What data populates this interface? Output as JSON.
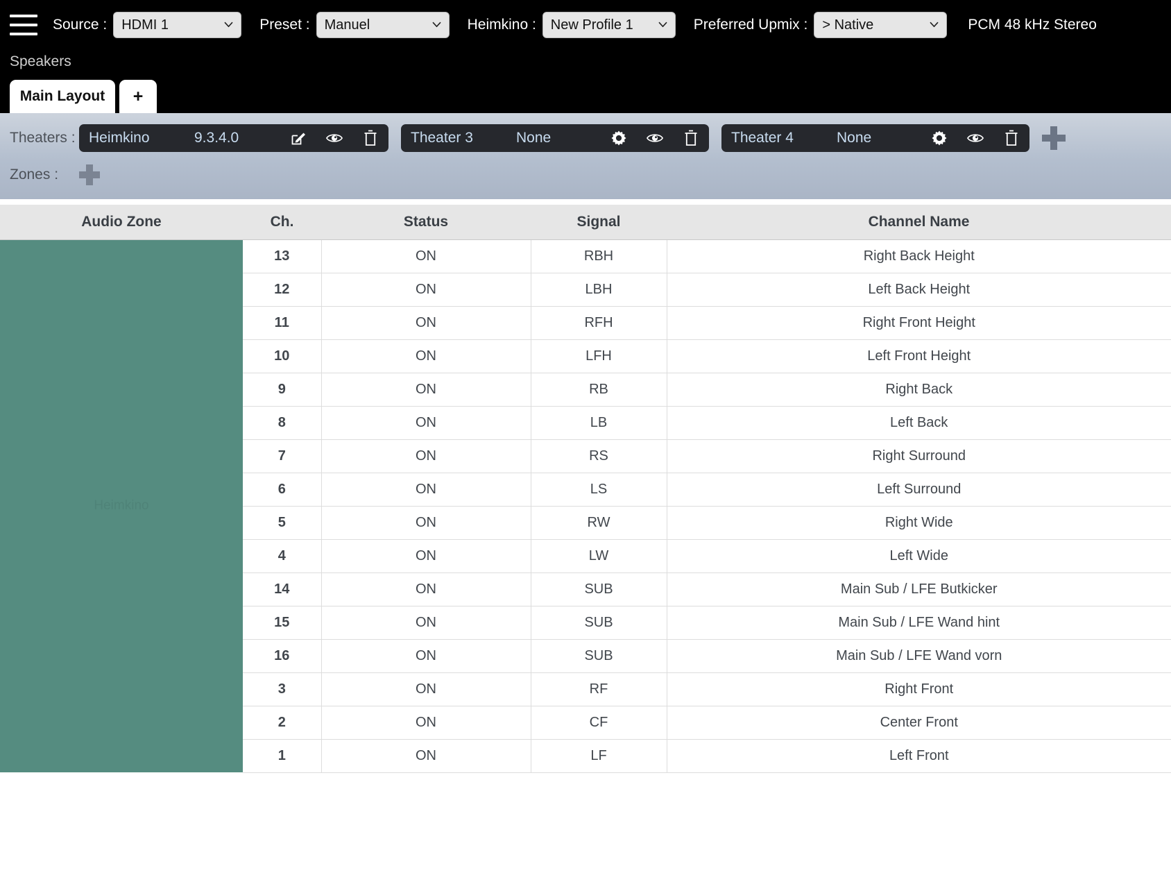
{
  "topbar": {
    "menu_icon": "hamburger-icon",
    "controls": [
      {
        "label": "Source :",
        "value": "HDMI 1",
        "icon": "chevron-down-icon"
      },
      {
        "label": "Preset :",
        "value": "Manuel",
        "icon": "chevron-down-icon"
      },
      {
        "label": "Heimkino :",
        "value": "New Profile 1",
        "icon": "chevron-down-icon"
      },
      {
        "label": "Preferred Upmix :",
        "value": "> Native",
        "icon": "chevron-down-icon"
      }
    ],
    "status": "PCM 48 kHz Stereo"
  },
  "section": {
    "title": "Speakers",
    "tabs": [
      {
        "label": "Main Layout",
        "active": true
      },
      {
        "label": "+",
        "active": false
      }
    ]
  },
  "theaters": {
    "label": "Theaters :",
    "add_label": "add-theater",
    "items": [
      {
        "name": "Heimkino",
        "value": "9.3.4.0",
        "icons": [
          "edit-icon",
          "eye-icon",
          "trash-icon"
        ]
      },
      {
        "name": "Theater 3",
        "value": "None",
        "icons": [
          "gear-icon",
          "eye-icon",
          "trash-icon"
        ]
      },
      {
        "name": "Theater 4",
        "value": "None",
        "icons": [
          "gear-icon",
          "eye-icon",
          "trash-icon"
        ]
      }
    ]
  },
  "zones": {
    "label": "Zones :",
    "add_label": "add-zone"
  },
  "table": {
    "headers": [
      "Audio Zone",
      "Ch.",
      "Status",
      "Signal",
      "Channel Name"
    ],
    "zone_name": "Heimkino",
    "rows": [
      {
        "ch": "13",
        "status": "ON",
        "signal": "RBH",
        "name": "Right Back Height"
      },
      {
        "ch": "12",
        "status": "ON",
        "signal": "LBH",
        "name": "Left Back Height"
      },
      {
        "ch": "11",
        "status": "ON",
        "signal": "RFH",
        "name": "Right Front Height"
      },
      {
        "ch": "10",
        "status": "ON",
        "signal": "LFH",
        "name": "Left Front Height"
      },
      {
        "ch": "9",
        "status": "ON",
        "signal": "RB",
        "name": "Right Back"
      },
      {
        "ch": "8",
        "status": "ON",
        "signal": "LB",
        "name": "Left Back"
      },
      {
        "ch": "7",
        "status": "ON",
        "signal": "RS",
        "name": "Right Surround"
      },
      {
        "ch": "6",
        "status": "ON",
        "signal": "LS",
        "name": "Left Surround"
      },
      {
        "ch": "5",
        "status": "ON",
        "signal": "RW",
        "name": "Right Wide"
      },
      {
        "ch": "4",
        "status": "ON",
        "signal": "LW",
        "name": "Left Wide"
      },
      {
        "ch": "14",
        "status": "ON",
        "signal": "SUB",
        "name": "Main Sub / LFE Butkicker"
      },
      {
        "ch": "15",
        "status": "ON",
        "signal": "SUB",
        "name": "Main Sub / LFE Wand hint"
      },
      {
        "ch": "16",
        "status": "ON",
        "signal": "SUB",
        "name": "Main Sub / LFE Wand vorn"
      },
      {
        "ch": "3",
        "status": "ON",
        "signal": "RF",
        "name": "Right Front"
      },
      {
        "ch": "2",
        "status": "ON",
        "signal": "CF",
        "name": "Center Front"
      },
      {
        "ch": "1",
        "status": "ON",
        "signal": "LF",
        "name": "Left Front"
      }
    ]
  },
  "colors": {
    "topbar_bg": "#000000",
    "panel_bg": "#b3bece",
    "chip_bg": "#26282d",
    "chip_text": "#c8dcf0",
    "zone_green": "#558c80",
    "header_bg": "#e6e6e6"
  }
}
